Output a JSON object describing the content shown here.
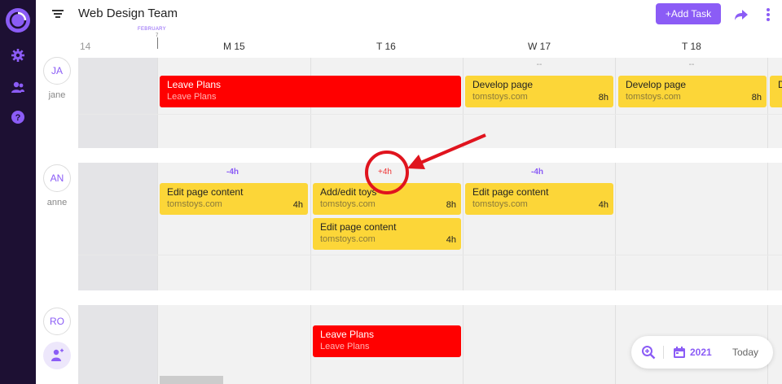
{
  "app": {
    "title": "Web Design Team",
    "add_task_label": "+Add Task"
  },
  "calendar": {
    "month": "FEBRUARY",
    "month_day": "7",
    "days": [
      {
        "label": "14",
        "dim": true
      },
      {
        "label": "M 15"
      },
      {
        "label": "T 16"
      },
      {
        "label": "W 17"
      },
      {
        "label": "T 18"
      }
    ]
  },
  "users": [
    {
      "initials": "JA",
      "name": "jane"
    },
    {
      "initials": "AN",
      "name": "anne"
    },
    {
      "initials": "RO",
      "name": ""
    }
  ],
  "jane": {
    "dash_1": "--",
    "dash_2": "--",
    "tasks": [
      {
        "name": "Leave Plans",
        "sub": "Leave Plans",
        "hours": "",
        "color": "red"
      },
      {
        "name": "Develop page",
        "sub": "tomstoys.com",
        "hours": "8h",
        "color": "yellow"
      },
      {
        "name": "Develop page",
        "sub": "tomstoys.com",
        "hours": "8h",
        "color": "yellow"
      },
      {
        "name": "D",
        "sub": "",
        "hours": "",
        "color": "yellow"
      }
    ]
  },
  "anne": {
    "hours_mon": "-4h",
    "hours_tue": "+4h",
    "hours_wed": "-4h",
    "tasks": [
      {
        "name": "Edit page content",
        "sub": "tomstoys.com",
        "hours": "4h",
        "color": "yellow"
      },
      {
        "name": "Add/edit toys",
        "sub": "tomstoys.com",
        "hours": "8h",
        "color": "yellow"
      },
      {
        "name": "Edit page content",
        "sub": "tomstoys.com",
        "hours": "4h",
        "color": "yellow"
      },
      {
        "name": "Edit page content",
        "sub": "tomstoys.com",
        "hours": "4h",
        "color": "yellow"
      }
    ]
  },
  "ro": {
    "tasks": [
      {
        "name": "Leave Plans",
        "sub": "Leave Plans",
        "hours": "",
        "color": "red"
      }
    ]
  },
  "footer": {
    "year": "2021",
    "today_label": "Today"
  },
  "icons": {
    "logo": "clock-logo-icon",
    "settings": "gear-icon",
    "users": "users-icon",
    "help": "help-icon",
    "menu": "sort-menu-icon",
    "share": "share-arrow-icon",
    "more": "more-vertical-icon",
    "zoom": "zoom-in-icon",
    "calendar": "calendar-icon",
    "add_user": "add-user-icon"
  },
  "colors": {
    "accent": "#8b5cf6",
    "sidebar": "#1d1033",
    "task_yellow": "#fcd638",
    "task_red": "#ff0000",
    "annotation": "#e0141e"
  }
}
